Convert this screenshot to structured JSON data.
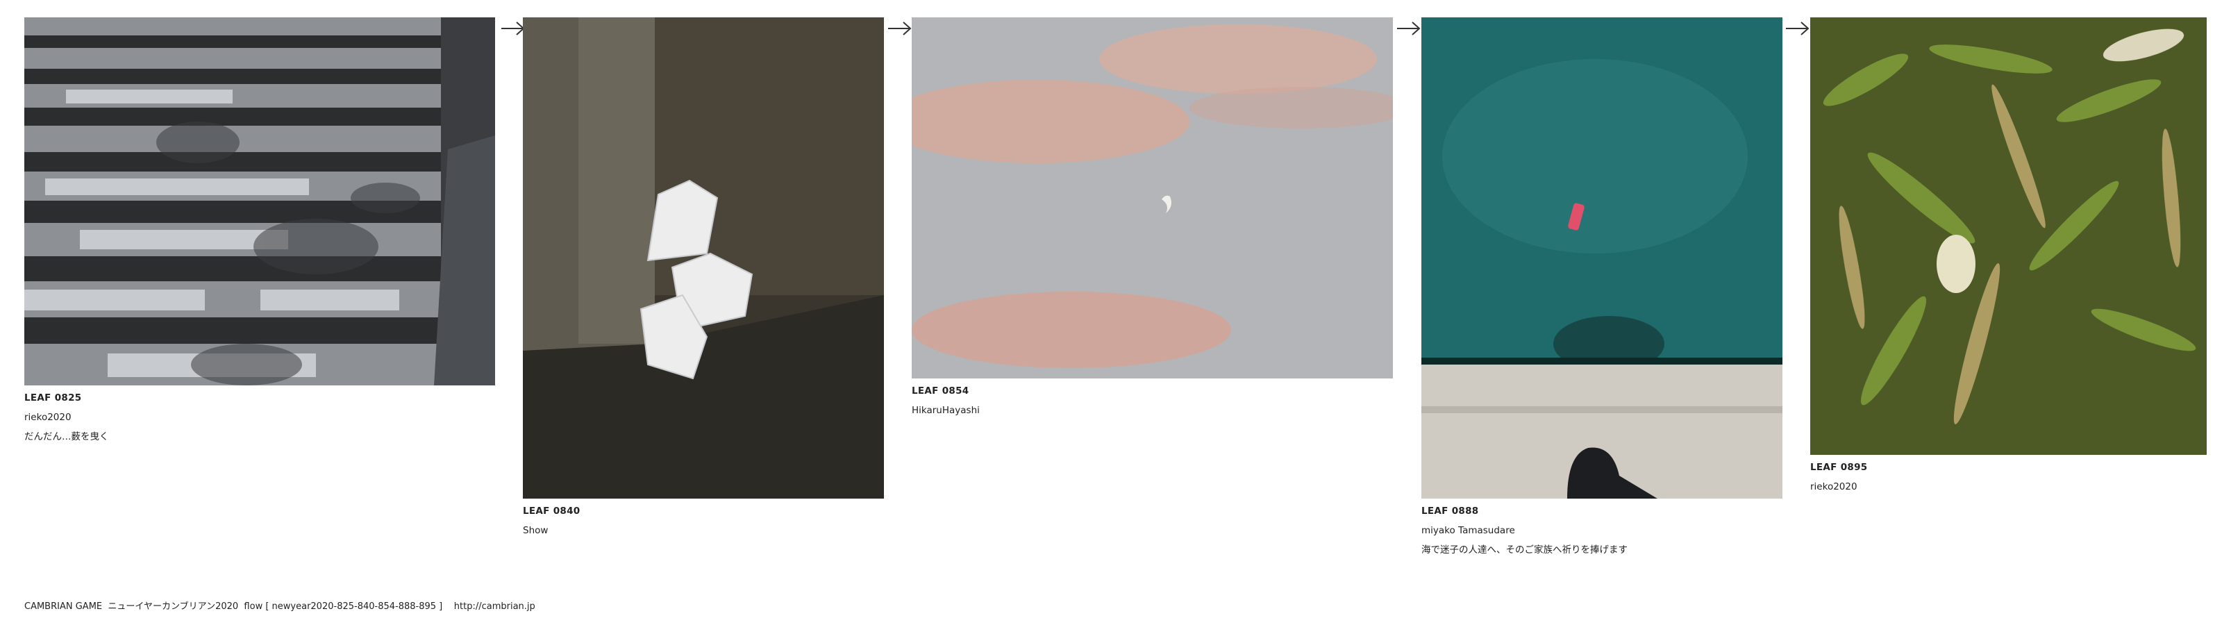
{
  "leaves": [
    {
      "id": "LEAF 0825",
      "author": "rieko2020",
      "comment": "だんだん…薮を曳く"
    },
    {
      "id": "LEAF 0840",
      "author": "Show",
      "comment": ""
    },
    {
      "id": "LEAF 0854",
      "author": "HikaruHayashi",
      "comment": ""
    },
    {
      "id": "LEAF 0888",
      "author": "miyako Tamasudare",
      "comment": "海で迷子の人達へ、そのご家族へ祈りを捧げます"
    },
    {
      "id": "LEAF 0895",
      "author": "rieko2020",
      "comment": ""
    }
  ],
  "arrow_icon": "right-arrow-icon",
  "footer": {
    "text": "CAMBRIAN GAME  ニューイヤーカンブリアン2020  flow [ newyear2020-825-840-854-888-895 ]    ",
    "link": "http://cambrian.jp"
  }
}
